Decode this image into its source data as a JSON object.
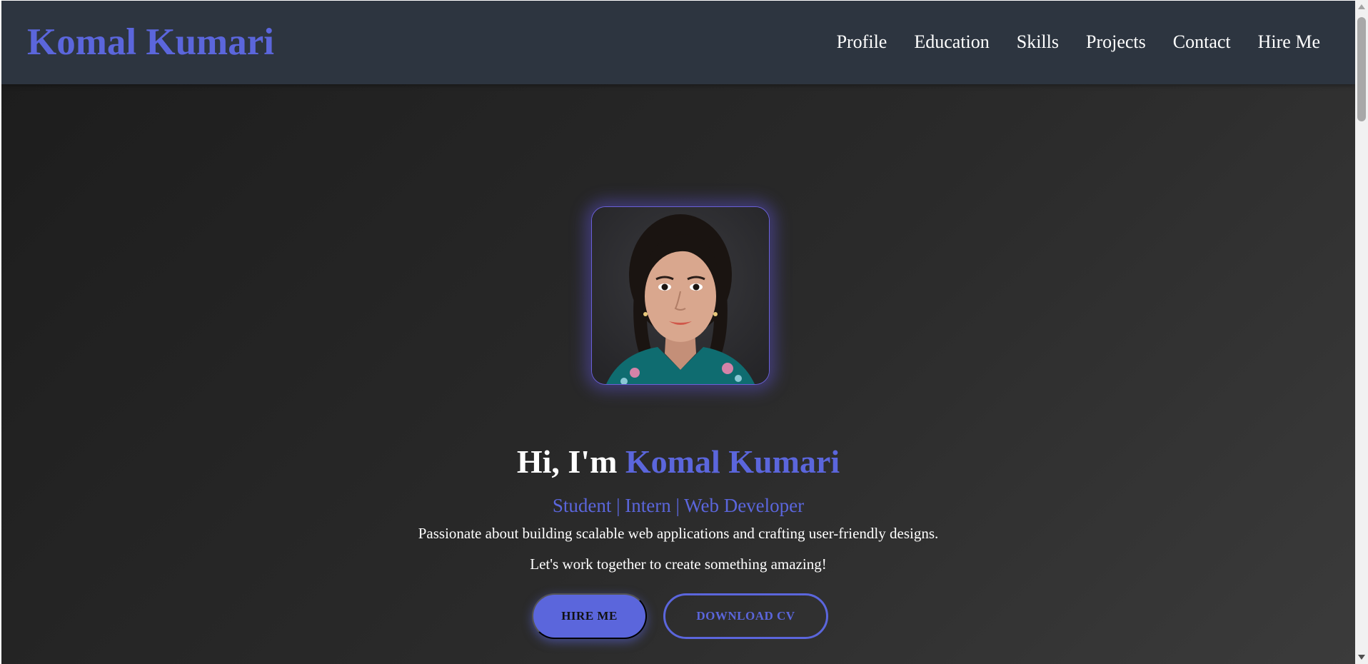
{
  "header": {
    "brand": "Komal Kumari",
    "nav": [
      {
        "label": "Profile"
      },
      {
        "label": "Education"
      },
      {
        "label": "Skills"
      },
      {
        "label": "Projects"
      },
      {
        "label": "Contact"
      },
      {
        "label": "Hire Me"
      }
    ]
  },
  "hero": {
    "photo_alt": "Komal Kumari profile photo",
    "greeting": "Hi, I'm",
    "name": "Komal Kumari",
    "subtitle": "Student | Intern | Web Developer",
    "description_line1": "Passionate about building scalable web applications and crafting user-friendly designs.",
    "description_line2": "Let's work together to create something amazing!",
    "primary_button": "HIRE ME",
    "secondary_button": "DOWNLOAD CV"
  },
  "colors": {
    "accent": "#5b66dc",
    "header_bg": "#2d3540",
    "page_bg": "#1c1c1c",
    "text": "#ffffff"
  },
  "icons": {
    "scroll_up": "triangle-up-icon",
    "scroll_down": "triangle-down-icon"
  }
}
